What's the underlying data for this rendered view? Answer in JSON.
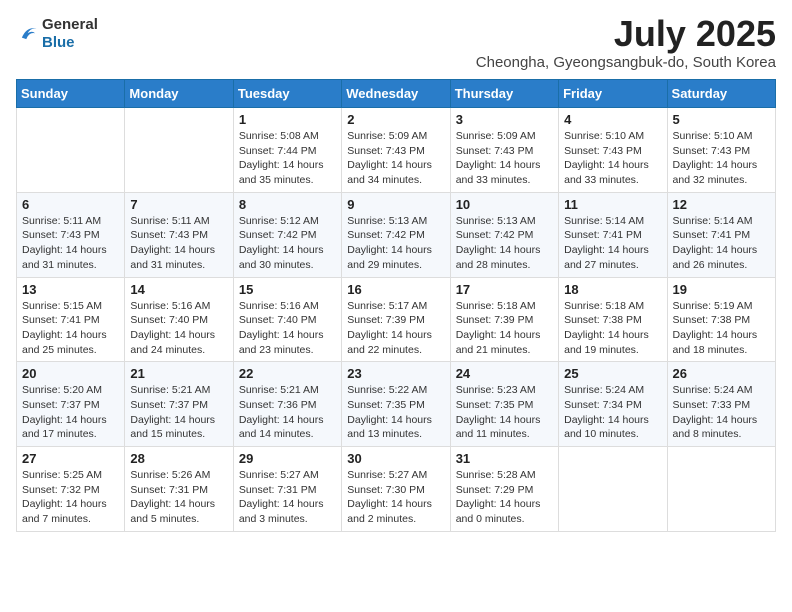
{
  "logo": {
    "general": "General",
    "blue": "Blue"
  },
  "title": {
    "month_year": "July 2025",
    "location": "Cheongha, Gyeongsangbuk-do, South Korea"
  },
  "weekdays": [
    "Sunday",
    "Monday",
    "Tuesday",
    "Wednesday",
    "Thursday",
    "Friday",
    "Saturday"
  ],
  "weeks": [
    [
      {
        "day": "",
        "info": ""
      },
      {
        "day": "",
        "info": ""
      },
      {
        "day": "1",
        "info": "Sunrise: 5:08 AM\nSunset: 7:44 PM\nDaylight: 14 hours and 35 minutes."
      },
      {
        "day": "2",
        "info": "Sunrise: 5:09 AM\nSunset: 7:43 PM\nDaylight: 14 hours and 34 minutes."
      },
      {
        "day": "3",
        "info": "Sunrise: 5:09 AM\nSunset: 7:43 PM\nDaylight: 14 hours and 33 minutes."
      },
      {
        "day": "4",
        "info": "Sunrise: 5:10 AM\nSunset: 7:43 PM\nDaylight: 14 hours and 33 minutes."
      },
      {
        "day": "5",
        "info": "Sunrise: 5:10 AM\nSunset: 7:43 PM\nDaylight: 14 hours and 32 minutes."
      }
    ],
    [
      {
        "day": "6",
        "info": "Sunrise: 5:11 AM\nSunset: 7:43 PM\nDaylight: 14 hours and 31 minutes."
      },
      {
        "day": "7",
        "info": "Sunrise: 5:11 AM\nSunset: 7:43 PM\nDaylight: 14 hours and 31 minutes."
      },
      {
        "day": "8",
        "info": "Sunrise: 5:12 AM\nSunset: 7:42 PM\nDaylight: 14 hours and 30 minutes."
      },
      {
        "day": "9",
        "info": "Sunrise: 5:13 AM\nSunset: 7:42 PM\nDaylight: 14 hours and 29 minutes."
      },
      {
        "day": "10",
        "info": "Sunrise: 5:13 AM\nSunset: 7:42 PM\nDaylight: 14 hours and 28 minutes."
      },
      {
        "day": "11",
        "info": "Sunrise: 5:14 AM\nSunset: 7:41 PM\nDaylight: 14 hours and 27 minutes."
      },
      {
        "day": "12",
        "info": "Sunrise: 5:14 AM\nSunset: 7:41 PM\nDaylight: 14 hours and 26 minutes."
      }
    ],
    [
      {
        "day": "13",
        "info": "Sunrise: 5:15 AM\nSunset: 7:41 PM\nDaylight: 14 hours and 25 minutes."
      },
      {
        "day": "14",
        "info": "Sunrise: 5:16 AM\nSunset: 7:40 PM\nDaylight: 14 hours and 24 minutes."
      },
      {
        "day": "15",
        "info": "Sunrise: 5:16 AM\nSunset: 7:40 PM\nDaylight: 14 hours and 23 minutes."
      },
      {
        "day": "16",
        "info": "Sunrise: 5:17 AM\nSunset: 7:39 PM\nDaylight: 14 hours and 22 minutes."
      },
      {
        "day": "17",
        "info": "Sunrise: 5:18 AM\nSunset: 7:39 PM\nDaylight: 14 hours and 21 minutes."
      },
      {
        "day": "18",
        "info": "Sunrise: 5:18 AM\nSunset: 7:38 PM\nDaylight: 14 hours and 19 minutes."
      },
      {
        "day": "19",
        "info": "Sunrise: 5:19 AM\nSunset: 7:38 PM\nDaylight: 14 hours and 18 minutes."
      }
    ],
    [
      {
        "day": "20",
        "info": "Sunrise: 5:20 AM\nSunset: 7:37 PM\nDaylight: 14 hours and 17 minutes."
      },
      {
        "day": "21",
        "info": "Sunrise: 5:21 AM\nSunset: 7:37 PM\nDaylight: 14 hours and 15 minutes."
      },
      {
        "day": "22",
        "info": "Sunrise: 5:21 AM\nSunset: 7:36 PM\nDaylight: 14 hours and 14 minutes."
      },
      {
        "day": "23",
        "info": "Sunrise: 5:22 AM\nSunset: 7:35 PM\nDaylight: 14 hours and 13 minutes."
      },
      {
        "day": "24",
        "info": "Sunrise: 5:23 AM\nSunset: 7:35 PM\nDaylight: 14 hours and 11 minutes."
      },
      {
        "day": "25",
        "info": "Sunrise: 5:24 AM\nSunset: 7:34 PM\nDaylight: 14 hours and 10 minutes."
      },
      {
        "day": "26",
        "info": "Sunrise: 5:24 AM\nSunset: 7:33 PM\nDaylight: 14 hours and 8 minutes."
      }
    ],
    [
      {
        "day": "27",
        "info": "Sunrise: 5:25 AM\nSunset: 7:32 PM\nDaylight: 14 hours and 7 minutes."
      },
      {
        "day": "28",
        "info": "Sunrise: 5:26 AM\nSunset: 7:31 PM\nDaylight: 14 hours and 5 minutes."
      },
      {
        "day": "29",
        "info": "Sunrise: 5:27 AM\nSunset: 7:31 PM\nDaylight: 14 hours and 3 minutes."
      },
      {
        "day": "30",
        "info": "Sunrise: 5:27 AM\nSunset: 7:30 PM\nDaylight: 14 hours and 2 minutes."
      },
      {
        "day": "31",
        "info": "Sunrise: 5:28 AM\nSunset: 7:29 PM\nDaylight: 14 hours and 0 minutes."
      },
      {
        "day": "",
        "info": ""
      },
      {
        "day": "",
        "info": ""
      }
    ]
  ]
}
